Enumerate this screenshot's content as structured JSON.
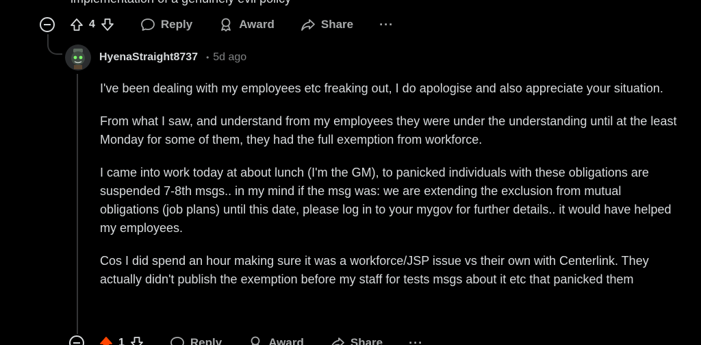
{
  "parent_comment": {
    "partial_text": "implementation of a genuinely evil policy",
    "vote_count": "4",
    "actions": {
      "reply": "Reply",
      "award": "Award",
      "share": "Share",
      "more": "···"
    }
  },
  "reply_comment": {
    "username": "HyenaStraight8737",
    "separator": "•",
    "timestamp": "5d ago",
    "paragraphs": [
      "I've been dealing with my employees etc freaking out, I do apologise and also appreciate your situation.",
      "From what I saw, and understand from my employees they were under the understanding until at the least Monday for some of them, they had the full exemption from workforce.",
      "I came into work today at about lunch (I'm the GM), to panicked individuals with these obligations are suspended 7-8th msgs.. in my mind if the msg was: we are extending the exclusion from mutual obligations (job plans) until this date, please log in to your mygov for further details.. it would have helped my employees.",
      "Cos I did spend an hour making sure it was a workforce/JSP issue vs their own with Centerlink. They actually didn't publish the exemption before my staff for tests msgs about it etc that panicked them"
    ],
    "vote_count": "1",
    "actions": {
      "reply": "Reply",
      "award": "Award",
      "share": "Share",
      "more": "···"
    }
  },
  "colors": {
    "background": "#000000",
    "text": "#d7dadc",
    "muted": "#818384",
    "upvote_active": "#ff4500"
  }
}
